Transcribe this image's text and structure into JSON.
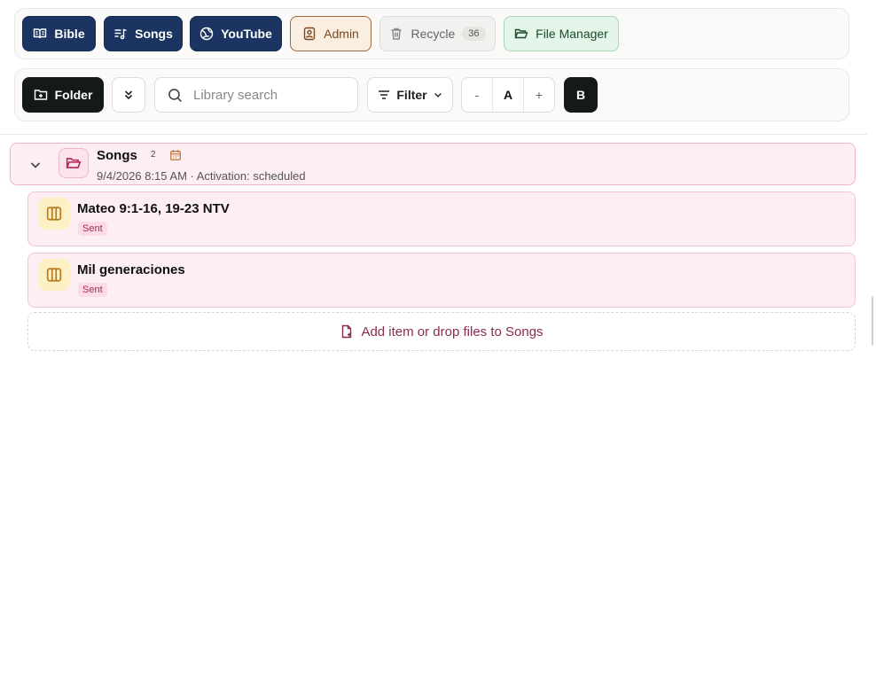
{
  "top_nav": {
    "bible": "Bible",
    "songs": "Songs",
    "youtube": "YouTube",
    "admin": "Admin",
    "recycle": "Recycle",
    "recycle_count": "36",
    "file_manager": "File Manager"
  },
  "toolbar": {
    "folder_button": "Folder",
    "search_placeholder": "Library search",
    "filter": "Filter",
    "font_decrease": "-",
    "font_label": "A",
    "font_increase": "+",
    "bold": "B"
  },
  "folder": {
    "title": "Songs",
    "count": "2",
    "meta": "9/4/2026 8:15 AM · Activation: scheduled",
    "items": [
      {
        "title": "Mateo 9:1-16, 19-23 NTV",
        "status": "Sent"
      },
      {
        "title": "Mil generaciones",
        "status": "Sent"
      }
    ],
    "add_label": "Add item or drop files to Songs"
  },
  "colors": {
    "navy": "#1b3461",
    "pink_row": "#fdeef3",
    "pink_accent": "#b22458",
    "dark_button": "#141a17"
  }
}
